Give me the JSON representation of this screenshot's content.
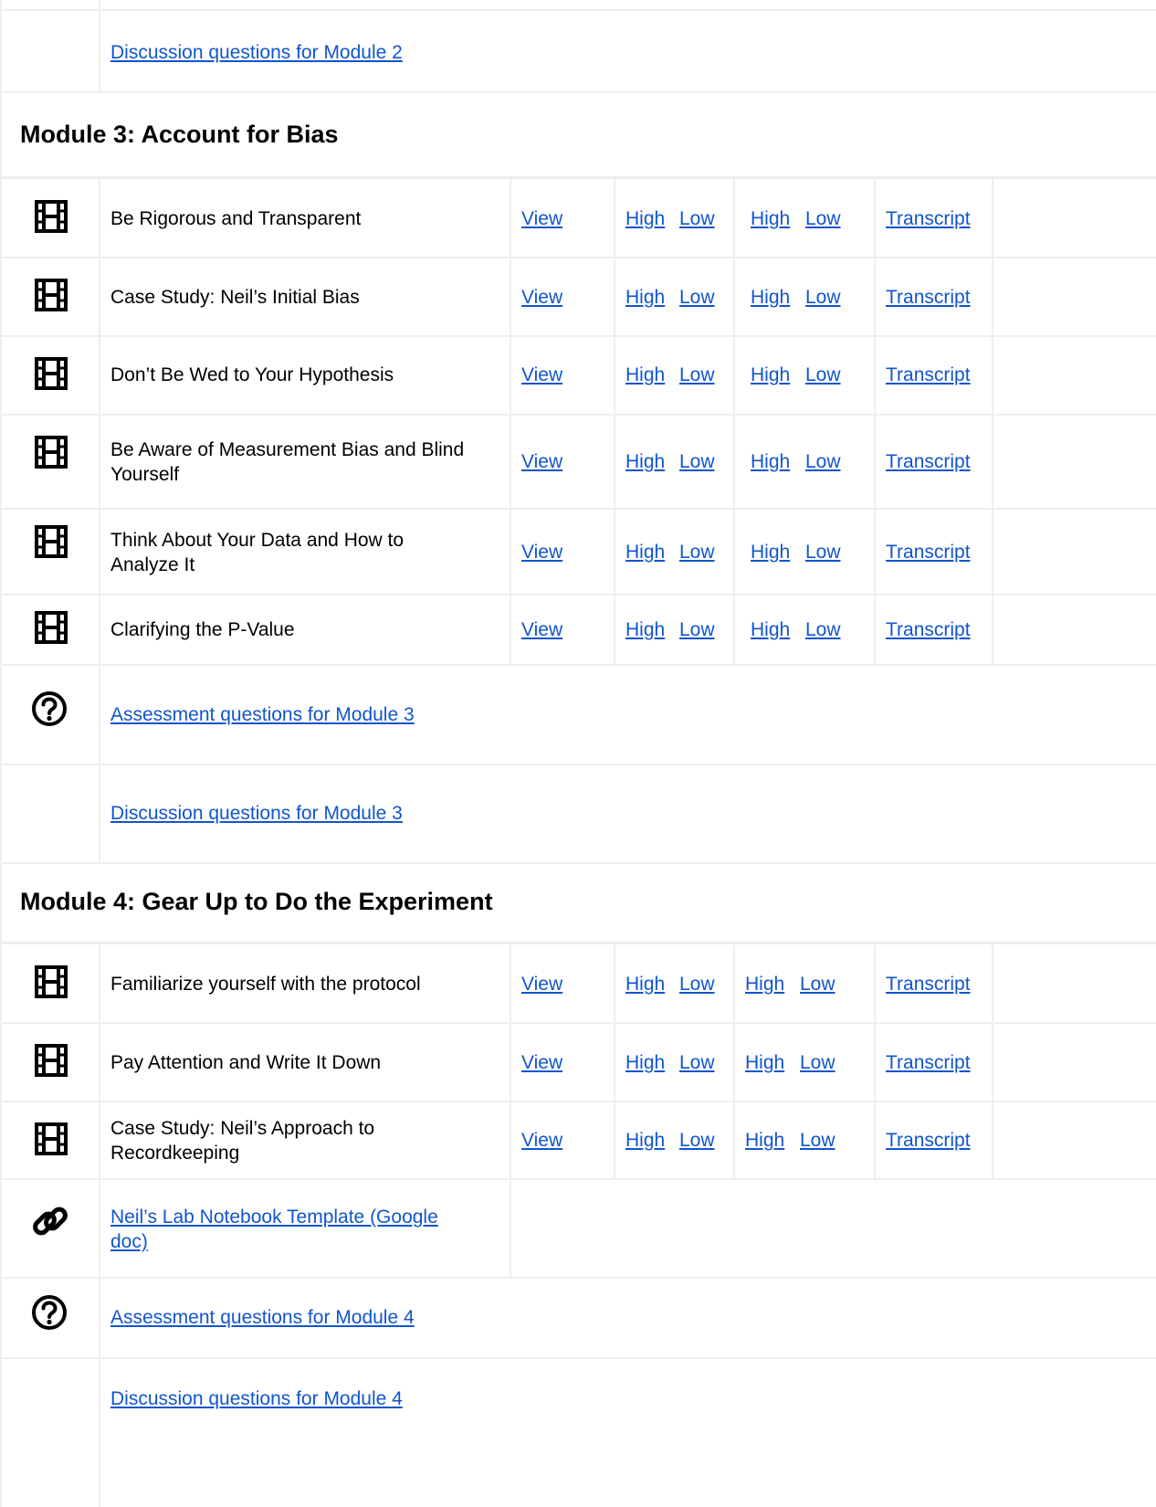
{
  "top": {
    "discussion_link": "Discussion questions for Module 2"
  },
  "module3": {
    "title": "Module 3: Account for Bias",
    "rows": [
      {
        "title": "Be Rigorous and Transparent",
        "view": "View",
        "high1": "High",
        "low1": "Low",
        "high2": "High",
        "low2": "Low",
        "transcript": "Transcript"
      },
      {
        "title": "Case Study: Neil’s Initial Bias",
        "view": "View",
        "high1": "High",
        "low1": "Low",
        "high2": "High",
        "low2": "Low",
        "transcript": "Transcript"
      },
      {
        "title": "Don’t Be Wed to Your Hypothesis",
        "view": "View",
        "high1": "High",
        "low1": "Low",
        "high2": "High",
        "low2": "Low",
        "transcript": "Transcript"
      },
      {
        "title_line1": "Be Aware of Measurement Bias and Blind",
        "title_line2": "Yourself",
        "view": "View",
        "high1": "High",
        "low1": "Low",
        "high2": "High",
        "low2": "Low",
        "transcript": "Transcript"
      },
      {
        "title_line1": "Think About Your Data and How to",
        "title_line2": "Analyze It",
        "view": "View",
        "high1": "High",
        "low1": "Low",
        "high2": "High",
        "low2": "Low",
        "transcript": "Transcript"
      },
      {
        "title": "Clarifying the P-Value",
        "view": "View",
        "high1": "High",
        "low1": "Low",
        "high2": "High",
        "low2": "Low",
        "transcript": "Transcript"
      }
    ],
    "assessment_link": "Assessment questions for Module 3",
    "discussion_link": "Discussion questions for Module 3"
  },
  "module4": {
    "title": "Module 4: Gear Up to Do the Experiment",
    "rows": [
      {
        "title": "Familiarize yourself with the protocol",
        "view": "View",
        "high1": "High",
        "low1": "Low",
        "high2": "High",
        "low2": "Low",
        "transcript": "Transcript"
      },
      {
        "title": "Pay Attention and Write It Down",
        "view": "View",
        "high1": "High",
        "low1": "Low",
        "high2": "High",
        "low2": "Low",
        "transcript": "Transcript"
      },
      {
        "title_line1": "Case Study: Neil’s Approach to",
        "title_line2": "Recordkeeping",
        "view": "View",
        "high1": "High",
        "low1": "Low",
        "high2": "High",
        "low2": "Low",
        "transcript": "Transcript"
      }
    ],
    "notebook_link_line1": "Neil’s Lab Notebook Template (Google",
    "notebook_link_line2": "doc)",
    "assessment_link": "Assessment questions for Module 4",
    "discussion_link": "Discussion questions for Module 4"
  },
  "icons": {
    "video": "film-icon",
    "question": "question-circle-icon",
    "link": "link-icon"
  },
  "colors": {
    "link": "#1155cc",
    "border": "#eeeeee"
  }
}
